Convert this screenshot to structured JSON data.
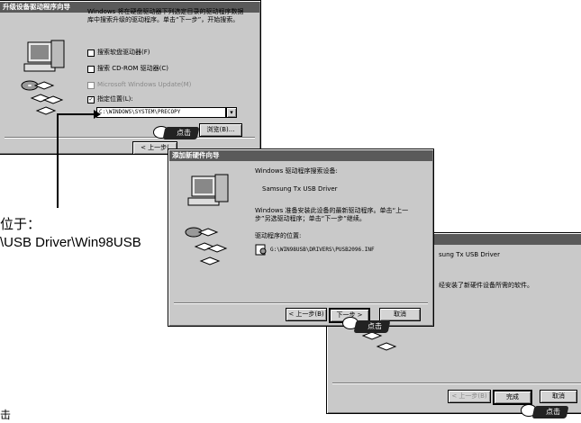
{
  "window1": {
    "title": "升级设备驱动程序向导",
    "description": "Windows 将在硬盘驱动器下列选定目录的驱动程序数据库中搜索升级的驱动程序。单击“下一步”，开始搜索。",
    "options": [
      {
        "label": "搜索软盘驱动器(F)",
        "checked": false,
        "disabled": false
      },
      {
        "label": "搜索 CD-ROM 驱动器(C)",
        "checked": false,
        "disabled": false
      },
      {
        "label": "Microsoft Windows Update(M)",
        "checked": false,
        "disabled": true
      },
      {
        "label": "指定位置(L):",
        "checked": true,
        "disabled": false
      }
    ],
    "location_value": "C:\\WINDOWS\\SYSTEM\\PRECOPY",
    "browse_label": "浏览(B)...",
    "back_label": "< 上一步(",
    "click_label": "点击"
  },
  "window2": {
    "title": "添加新硬件向导",
    "heading": "Windows 驱动程序搜索设备:",
    "device": "Samsung Tx USB Driver",
    "message": "Windows 准备安装此设备的最新驱动程序。单击“上一步”另选驱动程序；单击“下一步”继续。",
    "location_label": "驱动程序的位置:",
    "location_path": "G:\\WIN98USB\\DRIVERS\\PUSB2096.INF",
    "back_label": "< 上一步(B)",
    "next_label": "下一步 >",
    "cancel_label": "取消",
    "click_label": "点击"
  },
  "window3": {
    "device": "sung Tx USB Driver",
    "message": "经安装了新硬件设备所需的软件。",
    "back_label": "< 上一步(B)",
    "finish_label": "完成",
    "cancel_label": "取消",
    "click_label": "点击"
  },
  "annotation": {
    "line1": "位于：",
    "line2": "\\USB Driver\\Win98USB"
  },
  "bottom_left_char": "击"
}
